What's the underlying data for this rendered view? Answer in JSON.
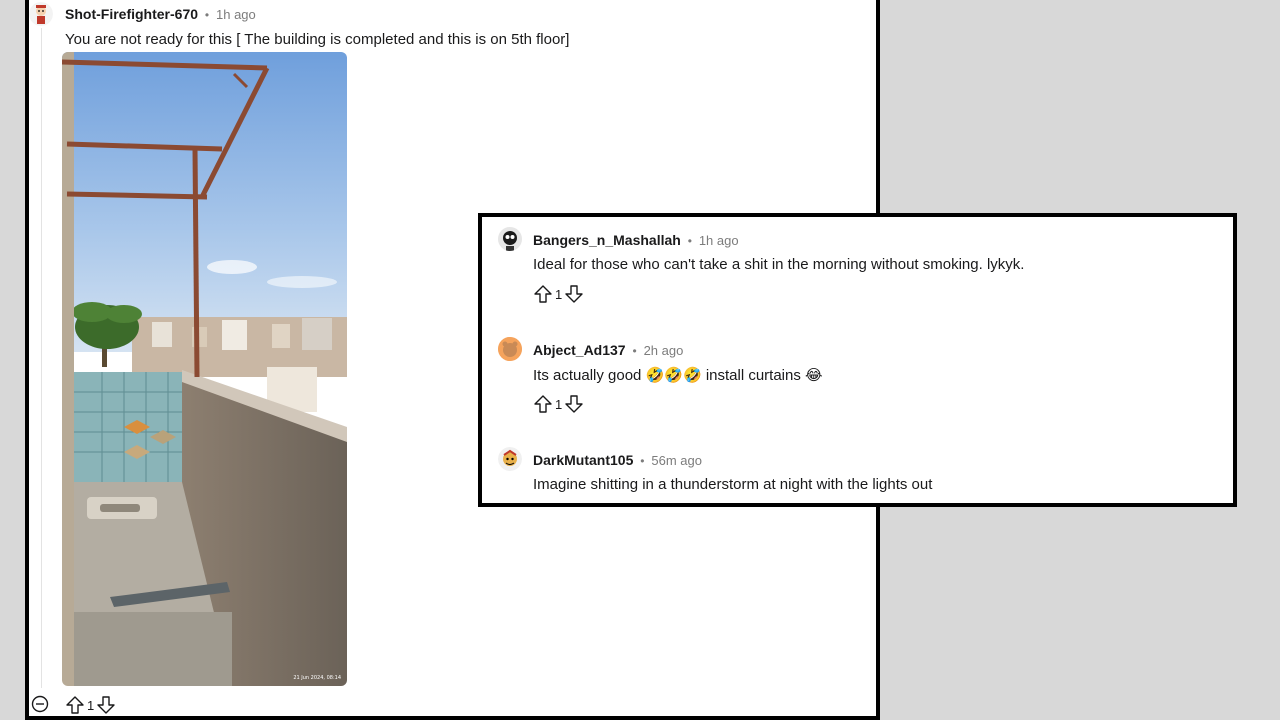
{
  "main_comment": {
    "username": "Shot-Firefighter-670",
    "separator": "•",
    "time": "1h ago",
    "text": "You are not ready for this [ The building is completed and this is on 5th floor]",
    "photo_timestamp": "21 Jun 2024, 08:14",
    "upvote_icon": "arrow-up-icon",
    "vote_count": "1",
    "downvote_icon": "arrow-down-icon",
    "collapse_icon": "minus-circle-icon"
  },
  "replies": [
    {
      "username": "Bangers_n_Mashallah",
      "separator": "•",
      "time": "1h ago",
      "text": "Ideal for those who can't take a shit in the morning without smoking. lykyk.",
      "vote_count": "1"
    },
    {
      "username": "Abject_Ad137",
      "separator": "•",
      "time": "2h ago",
      "text_before": "Its actually good",
      "emojis": [
        "🤣",
        "🤣",
        "🤣"
      ],
      "text_after": "install curtains",
      "trailing_emoji": "😂",
      "vote_count": "1"
    },
    {
      "username": "DarkMutant105",
      "separator": "•",
      "time": "56m ago",
      "text": "Imagine shitting in a thunderstorm at night with the lights out"
    }
  ],
  "colors": {
    "background": "#d8d8d8",
    "panel": "#ffffff",
    "border": "#000000",
    "meta_gray": "#7c7c7c",
    "text": "#1a1a1b"
  }
}
